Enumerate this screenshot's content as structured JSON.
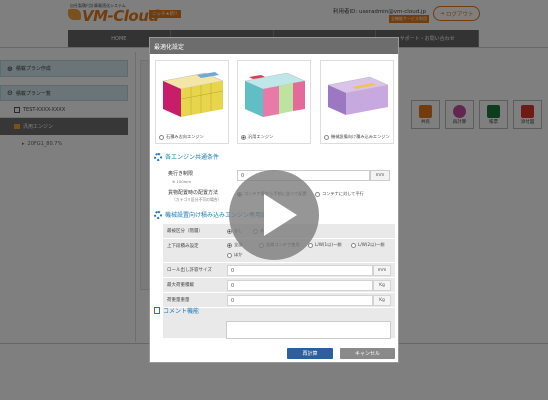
{
  "header": {
    "logo_subtitle": "自社製積付計算最適化システム",
    "logo_text": "VM-Cloud",
    "logo_badge": "ニッチ★新!!",
    "user_label": "利用者ID:  useradmin@vm-cloud.jp",
    "user_badge": "全機能サービス利用",
    "logout_label": "ログアウト"
  },
  "nav": {
    "items": [
      "HOME",
      "",
      "",
      "サポート・お問い合わせ"
    ]
  },
  "sidebar": {
    "plan_create": "積載プラン作成",
    "plan_list": "積載プラン一覧",
    "plan_id": "TEST-XXXX-XXXX",
    "engine": "汎用エンジン",
    "engine_child": "20FG1_80.7%"
  },
  "toolbar": {
    "share": "共有",
    "recalc": "再計算",
    "excel": "帳票",
    "pdf": "添付図"
  },
  "modal": {
    "title": "最適化設定",
    "containers": [
      {
        "label": "石積み志向エンジン",
        "selected": false
      },
      {
        "label": "汎用エンジン",
        "selected": true
      },
      {
        "label": "機械設備向け積み込みエンジン",
        "selected": false
      }
    ],
    "section_common": "各エンジン共通条件",
    "depth_label": "奥行き制限",
    "depth_sub": "※ 100mm",
    "depth_value": "0",
    "depth_unit": "mm",
    "placement_label": "貨物配置時の配置方法",
    "placement_sub": "（カテゴリ区分不可の場合）",
    "placement_options": [
      "コンテナ奥から手前に並べて配置",
      "コンテナの奥へ配置",
      "コンテナに対して平行"
    ],
    "section_machine": "機械設置向け積み込みエンジン専用設定",
    "machine_rows": [
      {
        "label": "最被区分（階層）",
        "options": [
          "なし",
          "なし",
          "あり"
        ]
      },
      {
        "label": "上下段積み設定",
        "options": [
          "全部",
          "上/下分なし",
          "混雑コンテナ使用",
          "L/W(1以)一側",
          "L/W(2以)一側",
          "ほか",
          "ほか以下の場合",
          "上あり"
        ]
      }
    ],
    "machine_fields": [
      {
        "label": "ロール出し許容サイズ",
        "value": "0",
        "unit": "mm"
      },
      {
        "label": "最大荷重積載",
        "value": "0",
        "unit": "Kg"
      },
      {
        "label": "荷重量重量",
        "value": "0",
        "unit": "Kg"
      }
    ],
    "section_comment": "コメント機能",
    "comment_value": "",
    "calc_button": "再計算",
    "cancel_button": "キャンセル"
  },
  "colors": {
    "brand_orange": "#e37b1c",
    "link_blue": "#1a7bb8",
    "calc_button": "#2d5f9e",
    "cancel_button": "#8a8a8a",
    "nav_gray": "#676767"
  }
}
